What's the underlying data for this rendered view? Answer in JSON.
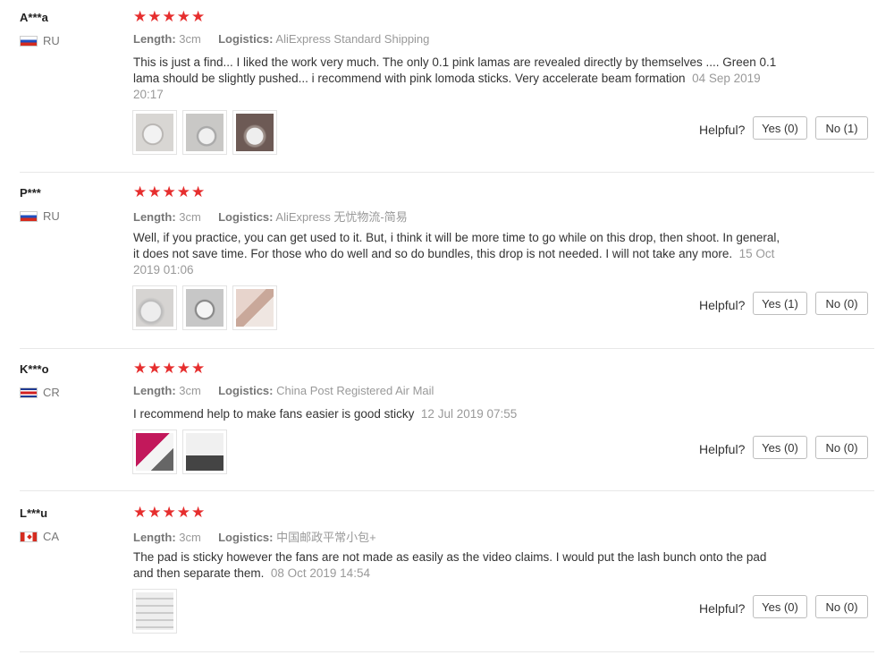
{
  "reviews": [
    {
      "user": "A***a",
      "country": "RU",
      "stars": "★★★★★",
      "length_label": "Length:",
      "length": "3cm",
      "logistics_label": "Logistics:",
      "logistics": "AliExpress Standard Shipping",
      "text": "This is just a find... I liked the work very much. The only 0.1 pink lamas are revealed directly by themselves .... Green 0.1 lama should be slightly pushed... i recommend with pink lomoda sticks. Very accelerate beam formation",
      "date": "04 Sep 2019 20:17",
      "helpful_label": "Helpful?",
      "yes": "Yes (0)",
      "no": "No (1)"
    },
    {
      "user": "P***",
      "country": "RU",
      "stars": "★★★★★",
      "length_label": "Length:",
      "length": "3cm",
      "logistics_label": "Logistics:",
      "logistics": "AliExpress 无忧物流-简易",
      "text": "Well, if you practice, you can get used to it. But, i think it will be more time to go while on this drop, then shoot. In general, it does not save time. For those who do well and so do bundles, this drop is not needed. I will not take any more.",
      "date": "15 Oct 2019 01:06",
      "helpful_label": "Helpful?",
      "yes": "Yes (1)",
      "no": "No (0)"
    },
    {
      "user": "K***o",
      "country": "CR",
      "stars": "★★★★★",
      "length_label": "Length:",
      "length": "3cm",
      "logistics_label": "Logistics:",
      "logistics": "China Post Registered Air Mail",
      "text": "I recommend help to make fans easier is good sticky",
      "date": "12 Jul 2019 07:55",
      "helpful_label": "Helpful?",
      "yes": "Yes (0)",
      "no": "No (0)"
    },
    {
      "user": "L***u",
      "country": "CA",
      "stars": "★★★★★",
      "length_label": "Length:",
      "length": "3cm",
      "logistics_label": "Logistics:",
      "logistics": "中国邮政平常小包+",
      "text": "The pad is sticky however the fans are not made as easily as the video claims. I would put the lash bunch onto the pad and then separate them.",
      "date": "08 Oct 2019 14:54",
      "helpful_label": "Helpful?",
      "yes": "Yes (0)",
      "no": "No (0)"
    }
  ]
}
